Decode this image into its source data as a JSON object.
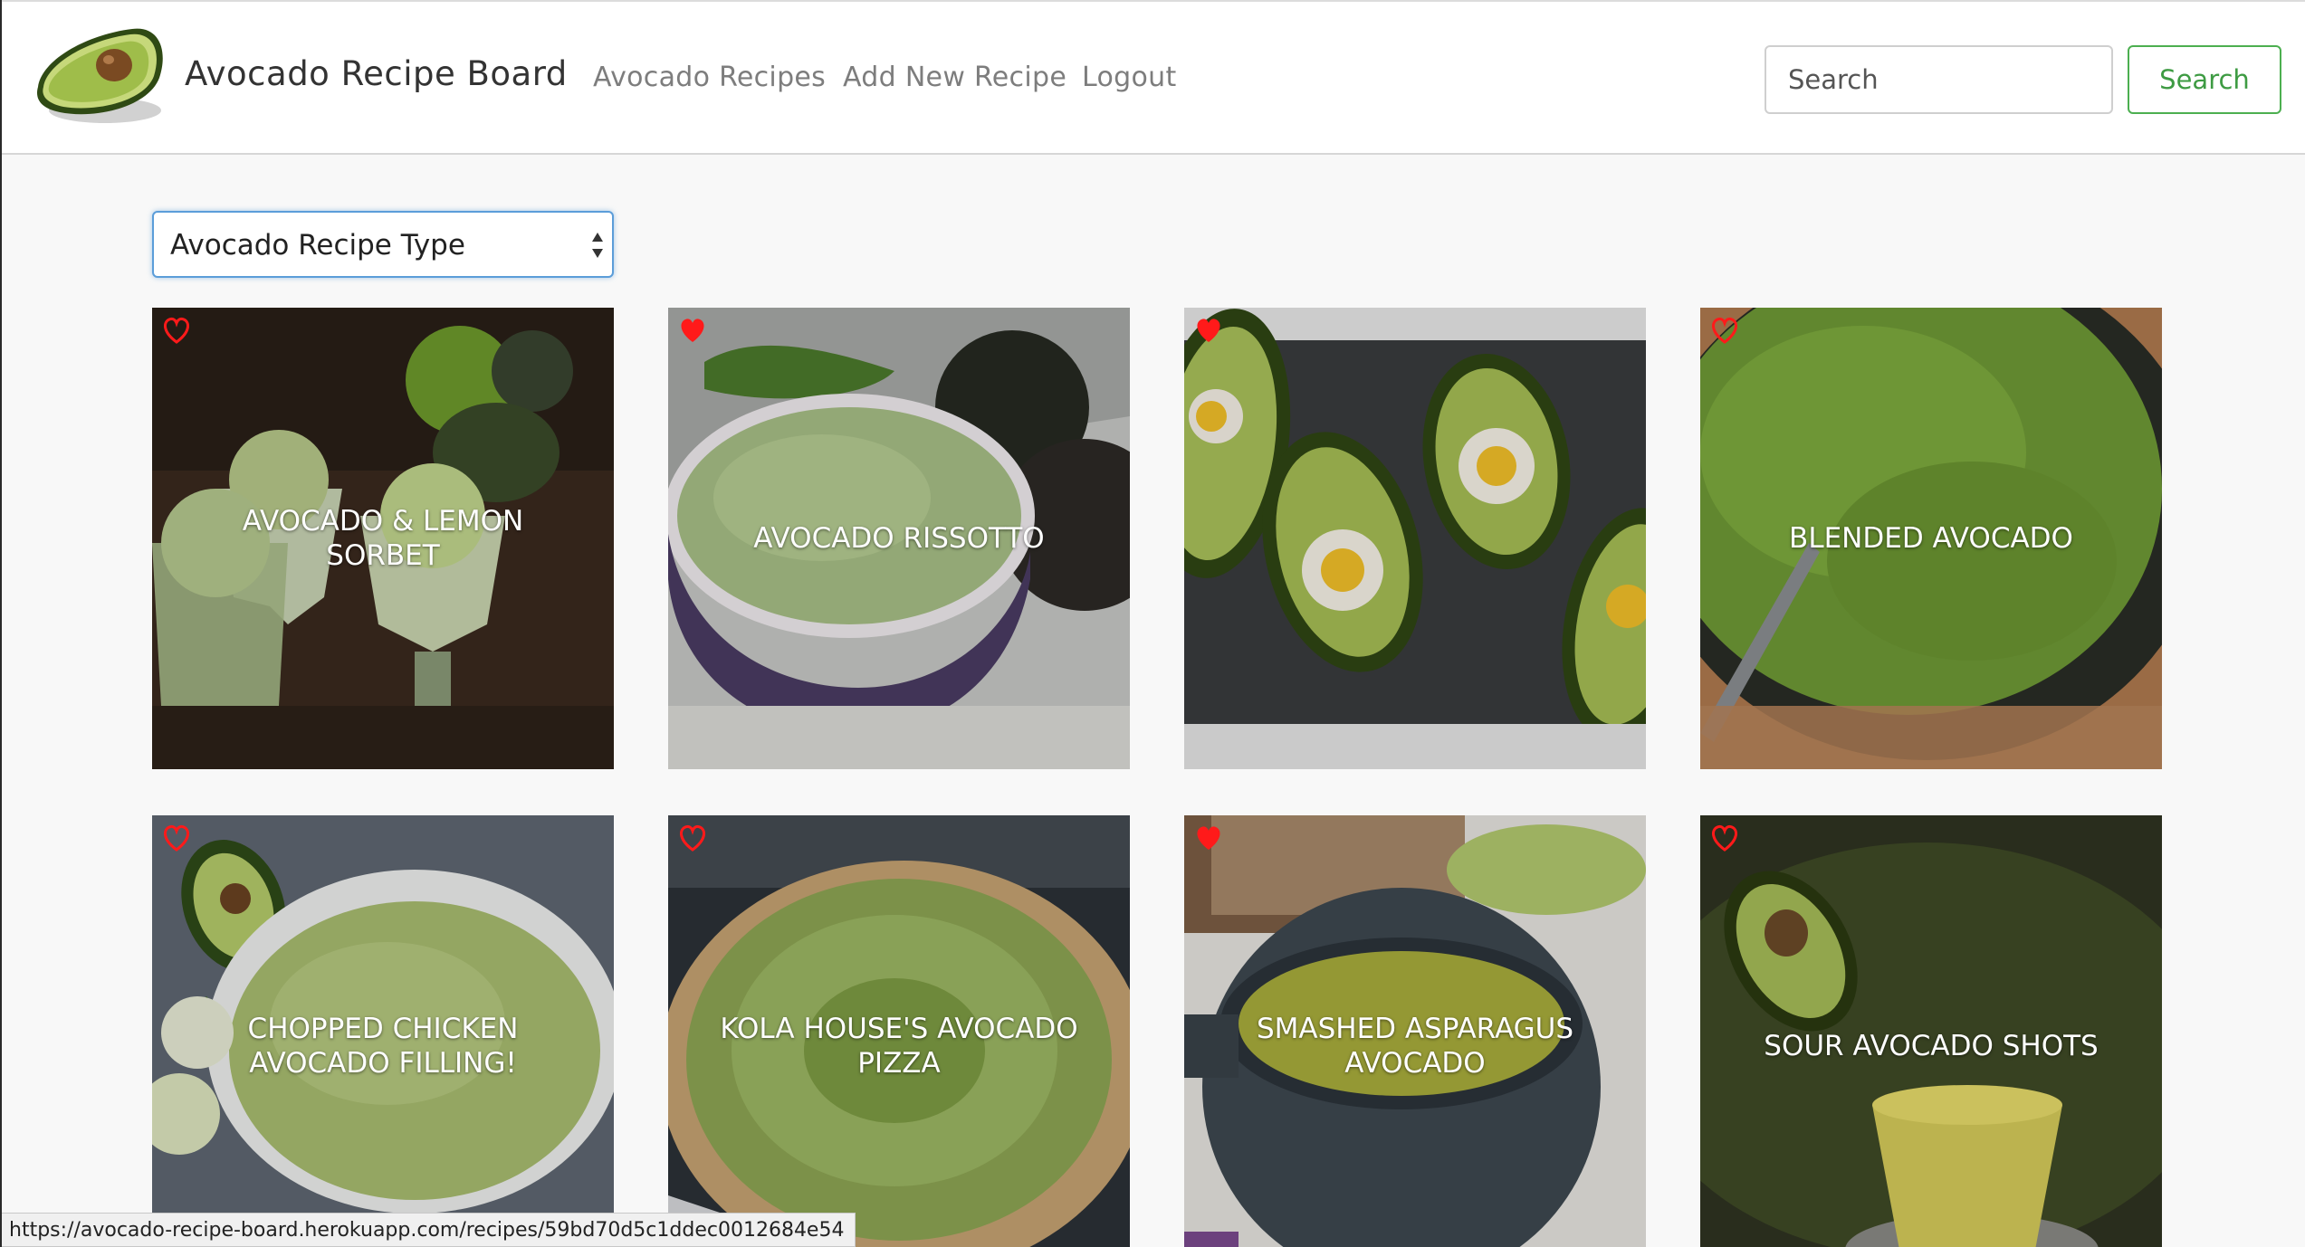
{
  "navbar": {
    "brand": "Avocado Recipe Board",
    "links": [
      "Avocado Recipes",
      "Add New Recipe",
      "Logout"
    ],
    "search_placeholder": "Search",
    "search_button": "Search"
  },
  "filter": {
    "selected": "Avocado Recipe Type"
  },
  "recipes": [
    {
      "title": "AVOCADO & LEMON\nSORBET",
      "favorited": false
    },
    {
      "title": "AVOCADO RISSOTTO",
      "favorited": true
    },
    {
      "title": "",
      "favorited": true
    },
    {
      "title": "BLENDED AVOCADO",
      "favorited": false
    },
    {
      "title": "CHOPPED CHICKEN\nAVOCADO FILLING!",
      "favorited": false
    },
    {
      "title": "KOLA HOUSE'S AVOCADO\nPIZZA",
      "favorited": false
    },
    {
      "title": "SMASHED ASPARAGUS\nAVOCADO",
      "favorited": true
    },
    {
      "title": "SOUR AVOCADO SHOTS",
      "favorited": false
    }
  ],
  "status_bar": {
    "url": "https://avocado-recipe-board.herokuapp.com/recipes/59bd70d5c1ddec0012684e54"
  },
  "colors": {
    "heart": "#ff1a1a",
    "search_button": "#4caf50",
    "select_focus": "#5b9dd9"
  }
}
